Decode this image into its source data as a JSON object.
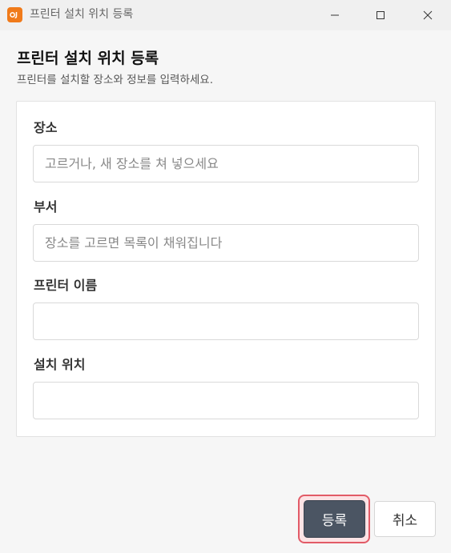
{
  "window": {
    "title": "프린터 설치 위치 등록",
    "app_icon": "orange-app-icon",
    "controls": [
      "minimize-icon",
      "maximize-icon",
      "close-icon"
    ]
  },
  "header": {
    "title": "프린터 설치 위치 등록",
    "subtitle": "프린터를 설치할 장소와 정보를 입력하세요."
  },
  "form": {
    "location": {
      "label": "장소",
      "placeholder": "고르거나, 새 장소를 쳐 넣으세요",
      "value": ""
    },
    "department": {
      "label": "부서",
      "placeholder": "장소를 고르면 목록이 채워집니다",
      "value": ""
    },
    "printer_name": {
      "label": "프린터 이름",
      "placeholder": "",
      "value": ""
    },
    "install_location": {
      "label": "설치 위치",
      "placeholder": "",
      "value": ""
    }
  },
  "footer": {
    "register_label": "등록",
    "cancel_label": "취소"
  },
  "colors": {
    "app_icon": "#f07a1a",
    "primary_button": "#4b5563",
    "focus_ring": "#e25b67"
  }
}
